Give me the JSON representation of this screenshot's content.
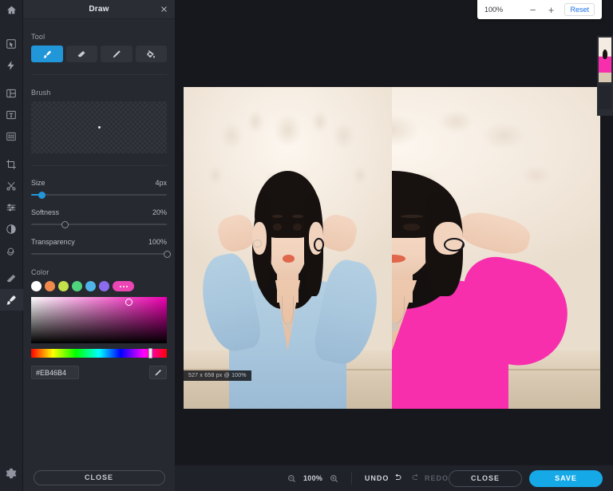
{
  "app": {
    "rail": {
      "home_icon": "home-icon",
      "items": [
        {
          "name": "select-tool",
          "icon": "cursor-select-icon",
          "active": false
        },
        {
          "name": "ai-effects-tool",
          "icon": "lightning-bolt-icon",
          "active": false
        },
        {
          "name": "layout-tool",
          "icon": "layout-frame-icon",
          "active": false
        },
        {
          "name": "text-tool",
          "icon": "text-box-icon",
          "active": false
        },
        {
          "name": "texture-tool",
          "icon": "texture-grid-icon",
          "active": false
        },
        {
          "name": "crop-tool",
          "icon": "crop-icon",
          "active": false
        },
        {
          "name": "cutout-tool",
          "icon": "scissors-icon",
          "active": false
        },
        {
          "name": "adjust-tool",
          "icon": "sliders-icon",
          "active": false
        },
        {
          "name": "contrast-tool",
          "icon": "contrast-circle-icon",
          "active": false
        },
        {
          "name": "retouch-tool",
          "icon": "swirl-icon",
          "active": false
        },
        {
          "name": "eraser-tool",
          "icon": "eraser-icon",
          "active": false
        },
        {
          "name": "draw-tool",
          "icon": "paint-brush-icon",
          "active": true
        }
      ],
      "settings_icon": "gear-icon"
    },
    "panel": {
      "title": "Draw",
      "close_icon": "close-x-icon",
      "tool_section_label": "Tool",
      "tools": [
        {
          "name": "brush",
          "icon": "paint-brush-icon",
          "active": true
        },
        {
          "name": "eraser",
          "icon": "eraser-icon",
          "active": false
        },
        {
          "name": "pen",
          "icon": "pen-icon",
          "active": false
        },
        {
          "name": "fill",
          "icon": "paint-bucket-icon",
          "active": false
        }
      ],
      "brush_section_label": "Brush",
      "sliders": [
        {
          "name": "size",
          "label": "Size",
          "value": "4px",
          "percent": 8,
          "style": "filled"
        },
        {
          "name": "softness",
          "label": "Softness",
          "value": "20%",
          "percent": 25,
          "style": "hollow"
        },
        {
          "name": "transparency",
          "label": "Transparency",
          "value": "100%",
          "percent": 100,
          "style": "hollow"
        }
      ],
      "color_section_label": "Color",
      "swatches": [
        {
          "name": "swatch-white",
          "color": "#ffffff"
        },
        {
          "name": "swatch-orange",
          "color": "#f08a4b"
        },
        {
          "name": "swatch-lime",
          "color": "#c4e04a"
        },
        {
          "name": "swatch-green",
          "color": "#4fd47e"
        },
        {
          "name": "swatch-blue",
          "color": "#4fb4e8"
        },
        {
          "name": "swatch-purple",
          "color": "#8b6cf0"
        }
      ],
      "more_colors": {
        "name": "more-colors-button",
        "color": "#eb46b4"
      },
      "picker": {
        "selected_color": "#EB46B4",
        "sv_cursor_x_percent": 72,
        "sv_cursor_y_percent": 12,
        "hue_knob_percent": 88
      },
      "hex_value": "#EB46B4",
      "hex_placeholder": "#EB46B4",
      "eyedropper_icon": "eyedropper-icon",
      "close_label": "CLOSE"
    },
    "canvas": {
      "size_label": "527 x 658 px @ 100%",
      "left_shirt_color": "#a6c5dc",
      "right_shirt_color": "#f72fad"
    },
    "bottom_bar": {
      "zoom_out_icon": "zoom-out-icon",
      "zoom_level": "100%",
      "zoom_in_icon": "zoom-in-icon",
      "undo_label": "UNDO",
      "undo_icon": "undo-arrow-icon",
      "redo_label": "REDO",
      "redo_icon": "redo-arrow-icon",
      "close_label": "CLOSE",
      "save_label": "SAVE",
      "save_color": "#16a9e8"
    },
    "zoom_popup": {
      "level": "100%",
      "minus_label": "−",
      "plus_label": "+",
      "reset_label": "Reset"
    },
    "filmstrip": {
      "selected_border_color": "#2a8fa8"
    }
  }
}
